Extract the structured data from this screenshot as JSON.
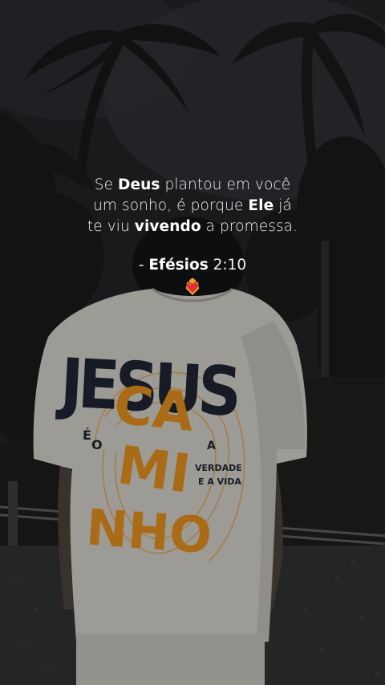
{
  "quote": {
    "line1_pre": "Se ",
    "line1_bold": "Deus",
    "line1_post": " plantou em você",
    "line2_pre": "um sonho, é porque ",
    "line2_bold": "Ele",
    "line2_post": " já",
    "line3_pre": "te viu ",
    "line3_bold": "vivendo",
    "line3_post": " a promessa."
  },
  "reference": {
    "dash": "- ",
    "book": "Efésios",
    "verse": " 2:10"
  },
  "emoji": "heart-on-fire-icon",
  "shirt": {
    "word_top": "JESUS",
    "letters_e": "É",
    "letters_o": "O",
    "word_ca": "CA",
    "word_mi": "MI",
    "word_nho": "NHO",
    "small_a": "A",
    "small_verdade": "VERDADE",
    "small_vida": "E A VIDA"
  },
  "colors": {
    "shirt_accent": "#d98a1c",
    "shirt_navy": "#1d2330",
    "shirt_white": "#c9c7c1"
  }
}
